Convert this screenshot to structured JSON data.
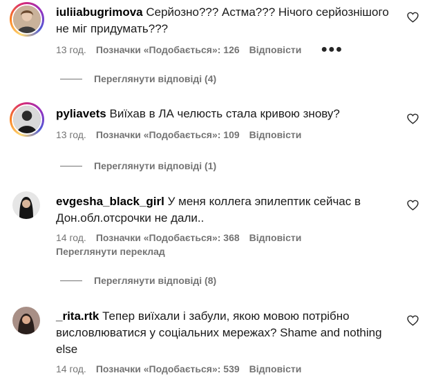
{
  "comments": [
    {
      "username": "iuliiabugrimova",
      "text": "Серйозно??? Астма??? Нічого серйознішого не міг придумать???",
      "time": "13 год.",
      "likes": "Позначки «Подобається»: 126",
      "reply": "Відповісти",
      "more_icon": "more-dots-icon",
      "replies": "Переглянути відповіді (4)"
    },
    {
      "username": "pyliavets",
      "text": "Виїхав в ЛА челюсть стала кривою знову?",
      "time": "13 год.",
      "likes": "Позначки «Подобається»: 109",
      "reply": "Відповісти",
      "replies": "Переглянути відповіді (1)"
    },
    {
      "username": "evgesha_black_girl",
      "text": "У меня коллега эпилептик сейчас в Дон.обл.отсрочки не дали..",
      "time": "14 год.",
      "likes": "Позначки «Подобається»: 368",
      "reply": "Відповісти",
      "translate": "Переглянути переклад",
      "replies": "Переглянути відповіді (8)"
    },
    {
      "username": "_rita.rtk",
      "text": "Тепер виїхали і забули, якою мовою потрібно висловлюватися у соціальних мережах? Shame and nothing else",
      "time": "14 год.",
      "likes": "Позначки «Подобається»: 539",
      "reply": "Відповісти"
    }
  ],
  "colors": {
    "secondary_text": "#737373",
    "primary_text": "#000000",
    "background": "#ffffff"
  },
  "icons": {
    "like": "heart-outline-icon",
    "more": "more-dots-icon"
  }
}
